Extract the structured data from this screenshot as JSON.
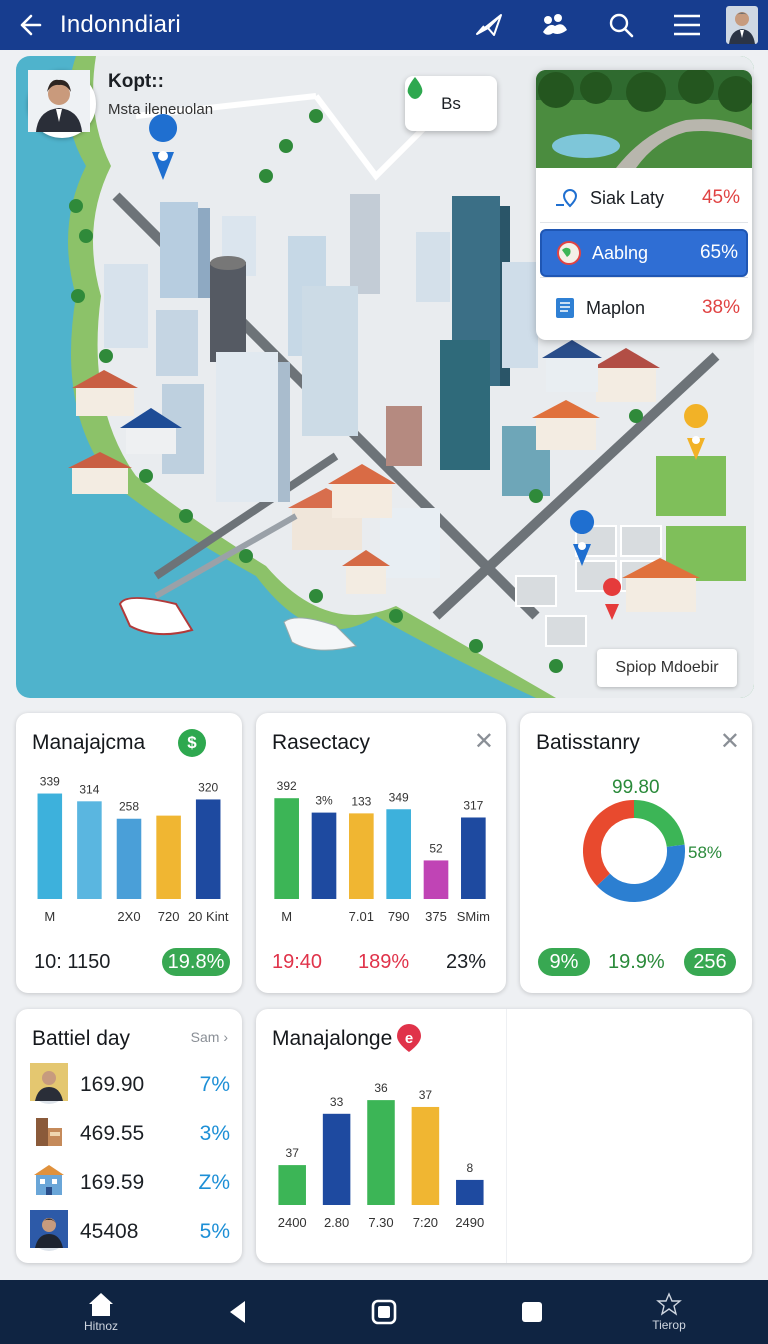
{
  "header": {
    "title": "Indonndiari"
  },
  "map": {
    "profile": {
      "name": "Kopt::",
      "subtitle": "Msta ileneuolan"
    },
    "top_button": {
      "label": "Bs"
    },
    "corner_button": {
      "label": "Spiop Mdoebir"
    },
    "panel": {
      "rows": [
        {
          "label": "Siak Laty",
          "value": "45%"
        },
        {
          "label": "Aablng",
          "value": "65%"
        },
        {
          "label": "Maplon",
          "value": "38%"
        }
      ]
    }
  },
  "cards": {
    "c1": {
      "title": "Manajajcma",
      "badge": "$",
      "footer_left": "10: 1150",
      "footer_pill": "19.8%"
    },
    "c2": {
      "title": "Rasectacy",
      "footer": [
        "19:40",
        "189%",
        "23%"
      ]
    },
    "c3": {
      "title": "Batisstanry",
      "center_top": "99.80",
      "side_label": "58%",
      "footer": [
        "9%",
        "19.9%",
        "256"
      ]
    },
    "c4": {
      "title": "Battiel day",
      "more": "Sam",
      "rows": [
        {
          "value": "169.90",
          "pct": "7%"
        },
        {
          "value": "469.55",
          "pct": "3%"
        },
        {
          "value": "169.59",
          "pct": "Z%"
        },
        {
          "value": "45408",
          "pct": "5%"
        }
      ]
    },
    "c5": {
      "title": "Manajalonge",
      "badge": "e"
    }
  },
  "bottom_nav": {
    "home": "Hitnoz",
    "right": "Tierop"
  },
  "chart_data": [
    {
      "type": "bar",
      "title": "Manajajcma",
      "categories": [
        "M",
        "",
        "2X0",
        "720",
        "20 Kint"
      ],
      "values": [
        339,
        314,
        258,
        268,
        320
      ],
      "value_labels": [
        "339",
        "314",
        "258",
        "",
        "320"
      ],
      "colors": [
        "#3db1dc",
        "#5ab6e0",
        "#4a9fd8",
        "#f0b632",
        "#1e4aa0"
      ],
      "ylim": [
        0,
        360
      ]
    },
    {
      "type": "bar",
      "title": "Rasectacy",
      "categories": [
        "M",
        "",
        "7.01",
        "790",
        "375",
        "SMim"
      ],
      "values": [
        392,
        336,
        333,
        349,
        150,
        317
      ],
      "value_labels": [
        "392",
        "3%",
        "133",
        "349",
        "52",
        "317"
      ],
      "colors": [
        "#3cb556",
        "#1e4aa0",
        "#f0b632",
        "#3db1dc",
        "#c044b5",
        "#1e4aa0"
      ],
      "ylim": [
        0,
        420
      ]
    },
    {
      "type": "pie",
      "title": "Batisstanry",
      "slices": [
        {
          "value": 23,
          "color": "#3cb556"
        },
        {
          "value": 40,
          "color": "#2c7fd1"
        },
        {
          "value": 37,
          "color": "#e84a2e"
        }
      ]
    },
    {
      "type": "bar",
      "title": "Manajalonge",
      "categories": [
        "2400",
        "2.80",
        "7.30",
        "7:20",
        "2490"
      ],
      "values": [
        37,
        33,
        36,
        37,
        8
      ],
      "value_labels": [
        "37",
        "33",
        "36",
        "37",
        "8"
      ],
      "colors": [
        "#3cb556",
        "#1e4aa0",
        "#3cb556",
        "#f0b632",
        "#1e4aa0"
      ],
      "heights": [
        0.35,
        0.8,
        0.92,
        0.86,
        0.22
      ]
    }
  ]
}
